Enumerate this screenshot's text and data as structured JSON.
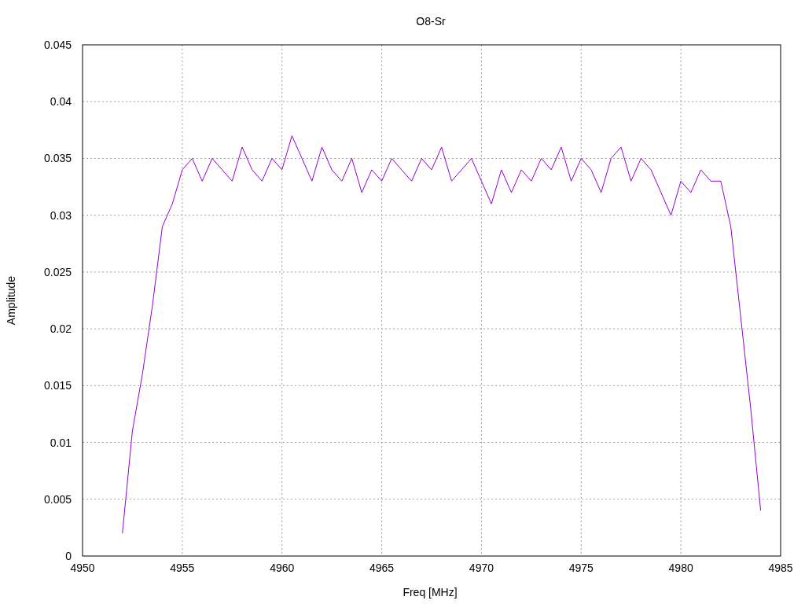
{
  "chart_data": {
    "type": "line",
    "grid": true,
    "title": "O8-Sr",
    "xlabel": "Freq [MHz]",
    "ylabel": "Amplitude",
    "xlim": [
      4950,
      4985
    ],
    "ylim": [
      0,
      0.045
    ],
    "xticks": [
      4950,
      4955,
      4960,
      4965,
      4970,
      4975,
      4980,
      4985
    ],
    "yticks": [
      {
        "value": 0,
        "label": "0"
      },
      {
        "value": 0.005,
        "label": "0.005"
      },
      {
        "value": 0.01,
        "label": "0.01"
      },
      {
        "value": 0.015,
        "label": "0.015"
      },
      {
        "value": 0.02,
        "label": "0.02"
      },
      {
        "value": 0.025,
        "label": "0.025"
      },
      {
        "value": 0.03,
        "label": "0.03"
      },
      {
        "value": 0.035,
        "label": "0.035"
      },
      {
        "value": 0.04,
        "label": "0.04"
      },
      {
        "value": 0.045,
        "label": "0.045"
      }
    ],
    "x": [
      4952,
      4952.5,
      4953,
      4953.5,
      4954,
      4954.5,
      4955,
      4955.5,
      4956,
      4956.5,
      4957,
      4957.5,
      4958,
      4958.5,
      4959,
      4959.5,
      4960,
      4960.5,
      4961,
      4961.5,
      4962,
      4962.5,
      4963,
      4963.5,
      4964,
      4964.5,
      4965,
      4965.5,
      4966,
      4966.5,
      4967,
      4967.5,
      4968,
      4968.5,
      4969,
      4969.5,
      4970,
      4970.5,
      4971,
      4971.5,
      4972,
      4972.5,
      4973,
      4973.5,
      4974,
      4974.5,
      4975,
      4975.5,
      4976,
      4976.5,
      4977,
      4977.5,
      4978,
      4978.5,
      4979,
      4979.5,
      4980,
      4980.5,
      4981,
      4981.5,
      4982,
      4982.5,
      4983,
      4983.5,
      4984
    ],
    "series": [
      {
        "color": "#9400d3",
        "values": [
          0.002,
          0.011,
          0.016,
          0.022,
          0.029,
          0.031,
          0.034,
          0.035,
          0.033,
          0.035,
          0.034,
          0.033,
          0.036,
          0.034,
          0.033,
          0.035,
          0.034,
          0.037,
          0.035,
          0.033,
          0.036,
          0.034,
          0.033,
          0.035,
          0.032,
          0.034,
          0.033,
          0.035,
          0.034,
          0.033,
          0.035,
          0.034,
          0.036,
          0.033,
          0.034,
          0.035,
          0.033,
          0.031,
          0.034,
          0.032,
          0.034,
          0.033,
          0.035,
          0.034,
          0.036,
          0.033,
          0.035,
          0.034,
          0.032,
          0.035,
          0.036,
          0.033,
          0.035,
          0.034,
          0.032,
          0.03,
          0.033,
          0.032,
          0.034,
          0.033,
          0.033,
          0.029,
          0.021,
          0.013,
          0.004
        ]
      }
    ]
  }
}
